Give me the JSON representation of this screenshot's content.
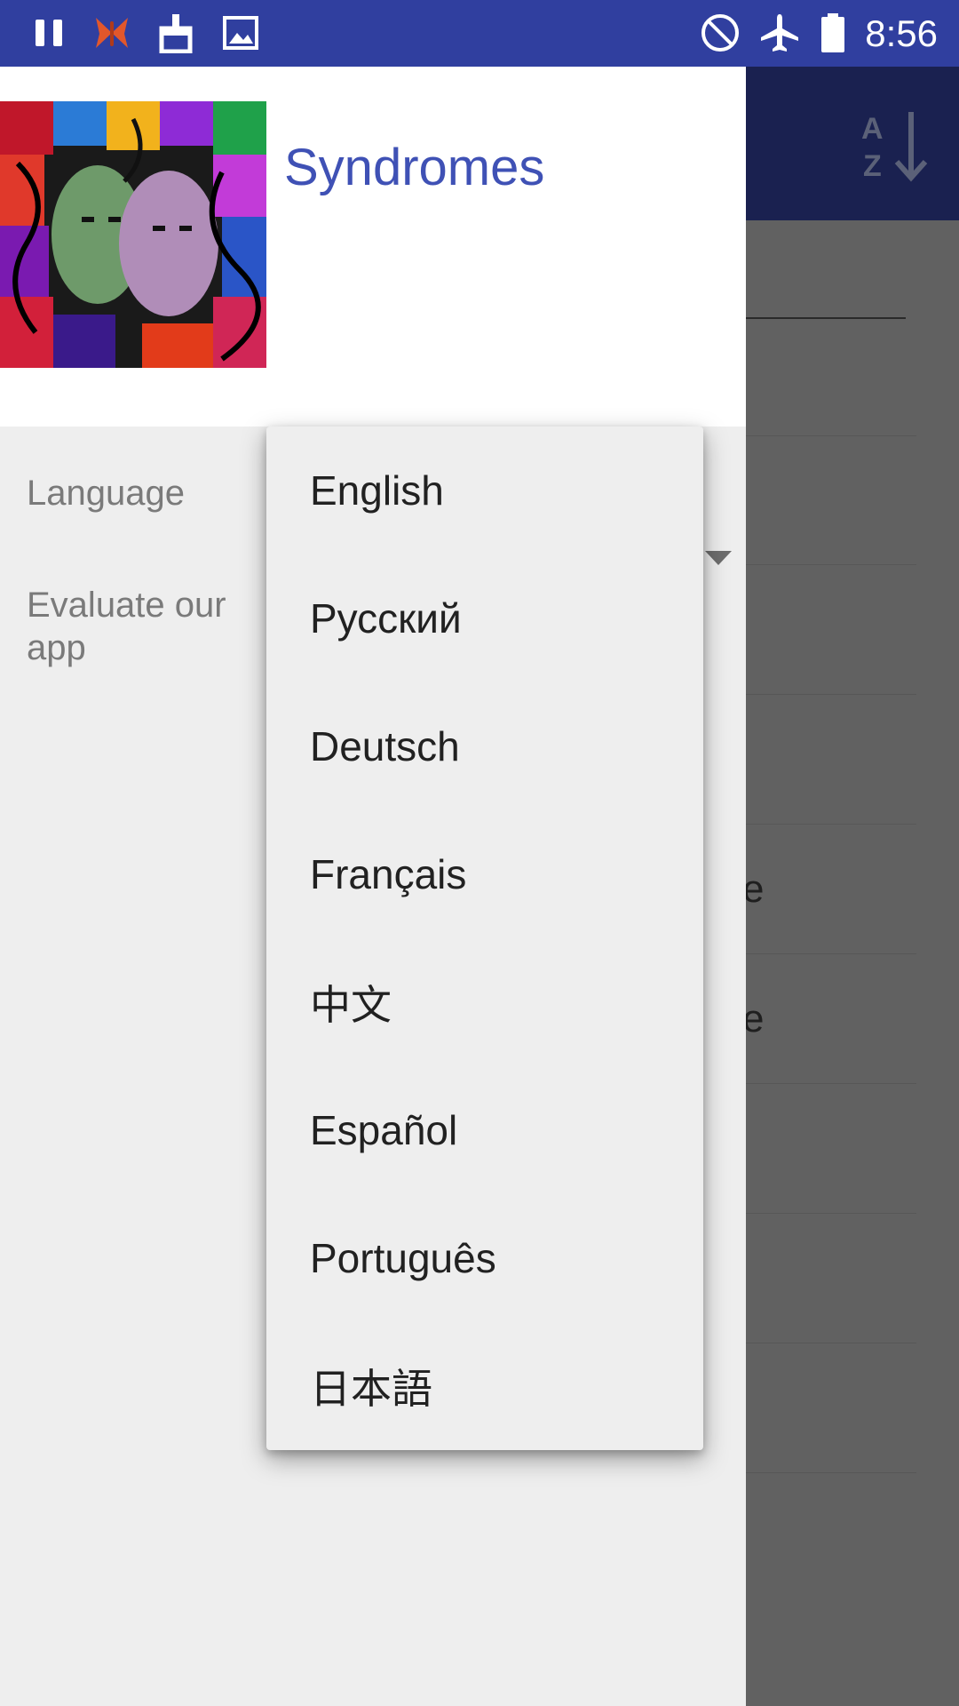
{
  "status_bar": {
    "time": "8:56"
  },
  "background_screen": {
    "partial_texts": [
      "e",
      "e"
    ]
  },
  "drawer": {
    "title": "Syndromes",
    "settings": [
      {
        "label": "Language"
      },
      {
        "label": "Evaluate our app"
      }
    ]
  },
  "language_popup": {
    "options": [
      "English",
      "Русский",
      "Deutsch",
      "Français",
      "中文",
      "Español",
      "Português",
      "日本語"
    ],
    "selected": "English"
  },
  "colors": {
    "status_bar": "#303f9f",
    "app_bar": "#1a2150",
    "title_accent": "#3f51b5",
    "drawer_bg": "#eeeeee",
    "scrim": "#616161"
  }
}
